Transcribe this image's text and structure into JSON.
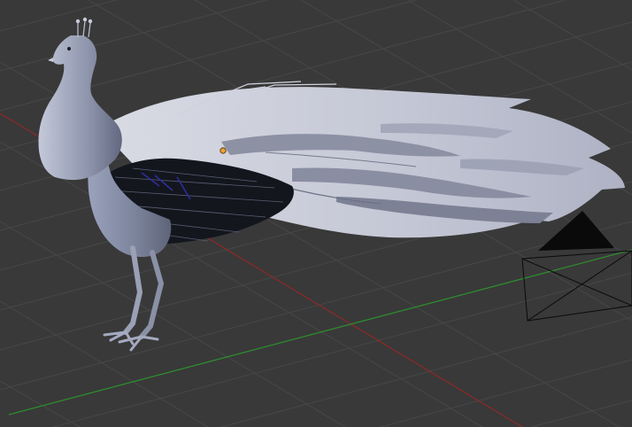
{
  "viewport": {
    "view_type": "3d-viewport",
    "background_color": "#393939",
    "grid_line_color": "#474747",
    "x_axis_color": "#8a2a2a",
    "y_axis_color": "#2f8a2f"
  },
  "scene_objects": [
    {
      "name": "peacock-mesh",
      "icon": "peacock-mesh",
      "body_color": "#8a92aa",
      "tail_color": "#c9ccd8",
      "wing_color": "#14161e"
    },
    {
      "name": "camera",
      "icon": "camera-icon",
      "color": "#0a0a0a"
    },
    {
      "name": "object-origin",
      "icon": "origin-dot",
      "color": "#f0a030"
    }
  ]
}
